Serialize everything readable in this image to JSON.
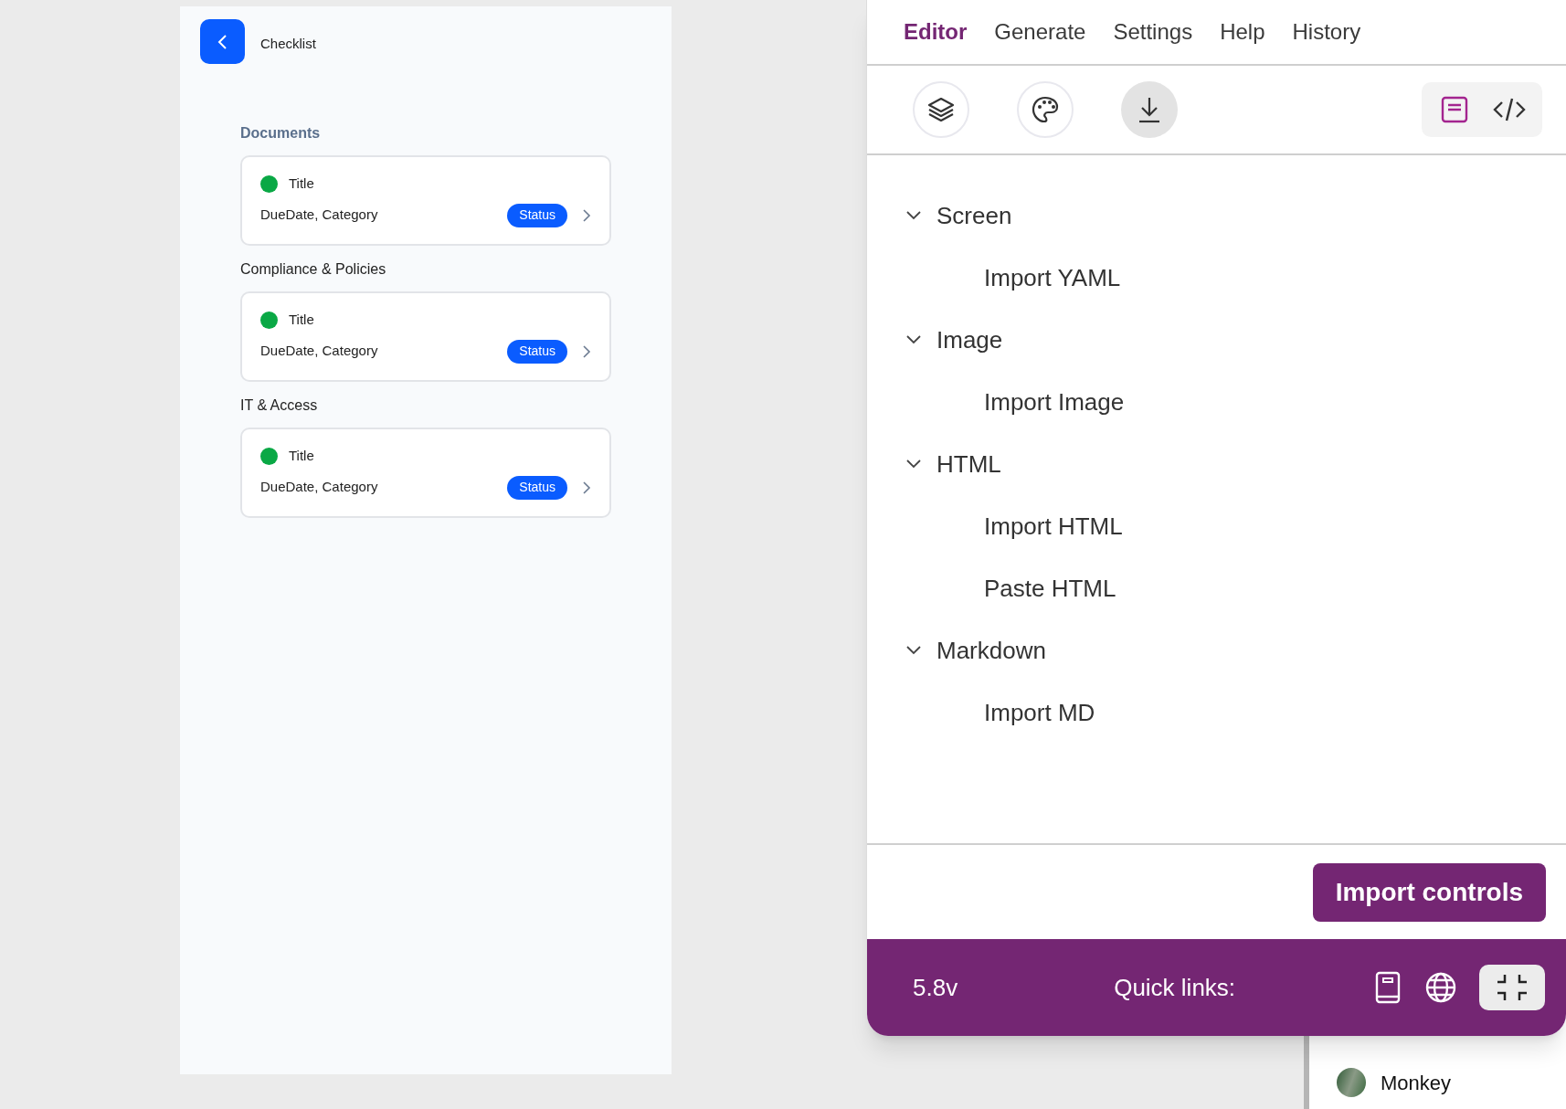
{
  "app_screen": {
    "title": "Checklist",
    "sections": [
      {
        "heading": "Documents",
        "highlighted": true,
        "items": [
          {
            "title": "Title",
            "subtitle": "DueDate, Category",
            "status": "Status",
            "color": "#0aa845"
          }
        ]
      },
      {
        "heading": "Compliance & Policies",
        "highlighted": false,
        "items": [
          {
            "title": "Title",
            "subtitle": "DueDate, Category",
            "status": "Status",
            "color": "#0aa845"
          }
        ]
      },
      {
        "heading": "IT & Access",
        "highlighted": false,
        "items": [
          {
            "title": "Title",
            "subtitle": "DueDate, Category",
            "status": "Status",
            "color": "#0aa845"
          }
        ]
      }
    ]
  },
  "editor": {
    "tabs": [
      {
        "label": "Editor",
        "selected": true
      },
      {
        "label": "Generate",
        "selected": false
      },
      {
        "label": "Settings",
        "selected": false
      },
      {
        "label": "Help",
        "selected": false
      },
      {
        "label": "History",
        "selected": false
      }
    ],
    "tools": [
      {
        "kind": "layers",
        "selected": false
      },
      {
        "kind": "palette",
        "selected": false
      },
      {
        "kind": "download",
        "selected": true
      }
    ],
    "views": [
      {
        "kind": "design",
        "selected": true
      },
      {
        "kind": "code",
        "selected": false
      }
    ],
    "tree": [
      {
        "label": "Screen",
        "expanded": true,
        "children": [
          {
            "label": "Import YAML"
          }
        ]
      },
      {
        "label": "Image",
        "expanded": true,
        "children": [
          {
            "label": "Import Image"
          }
        ]
      },
      {
        "label": "HTML",
        "expanded": true,
        "children": [
          {
            "label": "Import HTML"
          },
          {
            "label": "Paste HTML"
          }
        ]
      },
      {
        "label": "Markdown",
        "expanded": true,
        "children": [
          {
            "label": "Import MD"
          }
        ]
      }
    ],
    "primary_button": "Import controls",
    "footer": {
      "version": "5.8v",
      "quick_links_label": "Quick links:"
    }
  },
  "background_list": [
    {
      "label": "Monkey"
    }
  ]
}
